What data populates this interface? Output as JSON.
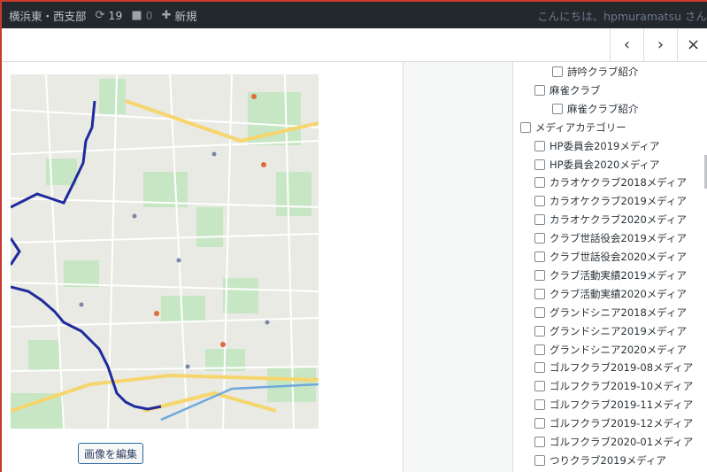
{
  "admin_bar": {
    "site_name": "横浜東・西支部",
    "updates_count": "19",
    "comments_count": "0",
    "new_label": "新規",
    "greeting": "こんにちは、hpmuramatsu さん"
  },
  "modal": {
    "prev_glyph": "‹",
    "next_glyph": "›",
    "close_glyph": "×",
    "edit_image_label": "画像を編集"
  },
  "categories": [
    {
      "label": "詩吟クラブ紹介",
      "level": 2
    },
    {
      "label": "麻雀クラブ",
      "level": 1
    },
    {
      "label": "麻雀クラブ紹介",
      "level": 2
    },
    {
      "label": "メディアカテゴリー",
      "level": 0
    },
    {
      "label": "HP委員会2019メディア",
      "level": 1
    },
    {
      "label": "HP委員会2020メディア",
      "level": 1
    },
    {
      "label": "カラオケクラブ2018メディア",
      "level": 1
    },
    {
      "label": "カラオケクラブ2019メディア",
      "level": 1
    },
    {
      "label": "カラオケクラブ2020メディア",
      "level": 1
    },
    {
      "label": "クラブ世話役会2019メディア",
      "level": 1
    },
    {
      "label": "クラブ世話役会2020メディア",
      "level": 1
    },
    {
      "label": "クラブ活動実績2019メディア",
      "level": 1
    },
    {
      "label": "クラブ活動実績2020メディア",
      "level": 1
    },
    {
      "label": "グランドシニア2018メディア",
      "level": 1
    },
    {
      "label": "グランドシニア2019メディア",
      "level": 1
    },
    {
      "label": "グランドシニア2020メディア",
      "level": 1
    },
    {
      "label": "ゴルフクラブ2019-08メディア",
      "level": 1
    },
    {
      "label": "ゴルフクラブ2019-10メディア",
      "level": 1
    },
    {
      "label": "ゴルフクラブ2019-11メディア",
      "level": 1
    },
    {
      "label": "ゴルフクラブ2019-12メディア",
      "level": 1
    },
    {
      "label": "ゴルフクラブ2020-01メディア",
      "level": 1
    },
    {
      "label": "つりクラブ2019メディア",
      "level": 1
    }
  ],
  "colors": {
    "admin_bar_bg": "#23282d",
    "frame_red": "#c83a2e",
    "route_blue": "#1f2a9e",
    "map_green": "#c7e6c4",
    "map_road_yellow": "#f7d56e"
  },
  "icons": [
    "updates-icon",
    "comment-icon",
    "plus-icon",
    "chevron-left-icon",
    "chevron-right-icon",
    "close-icon"
  ]
}
